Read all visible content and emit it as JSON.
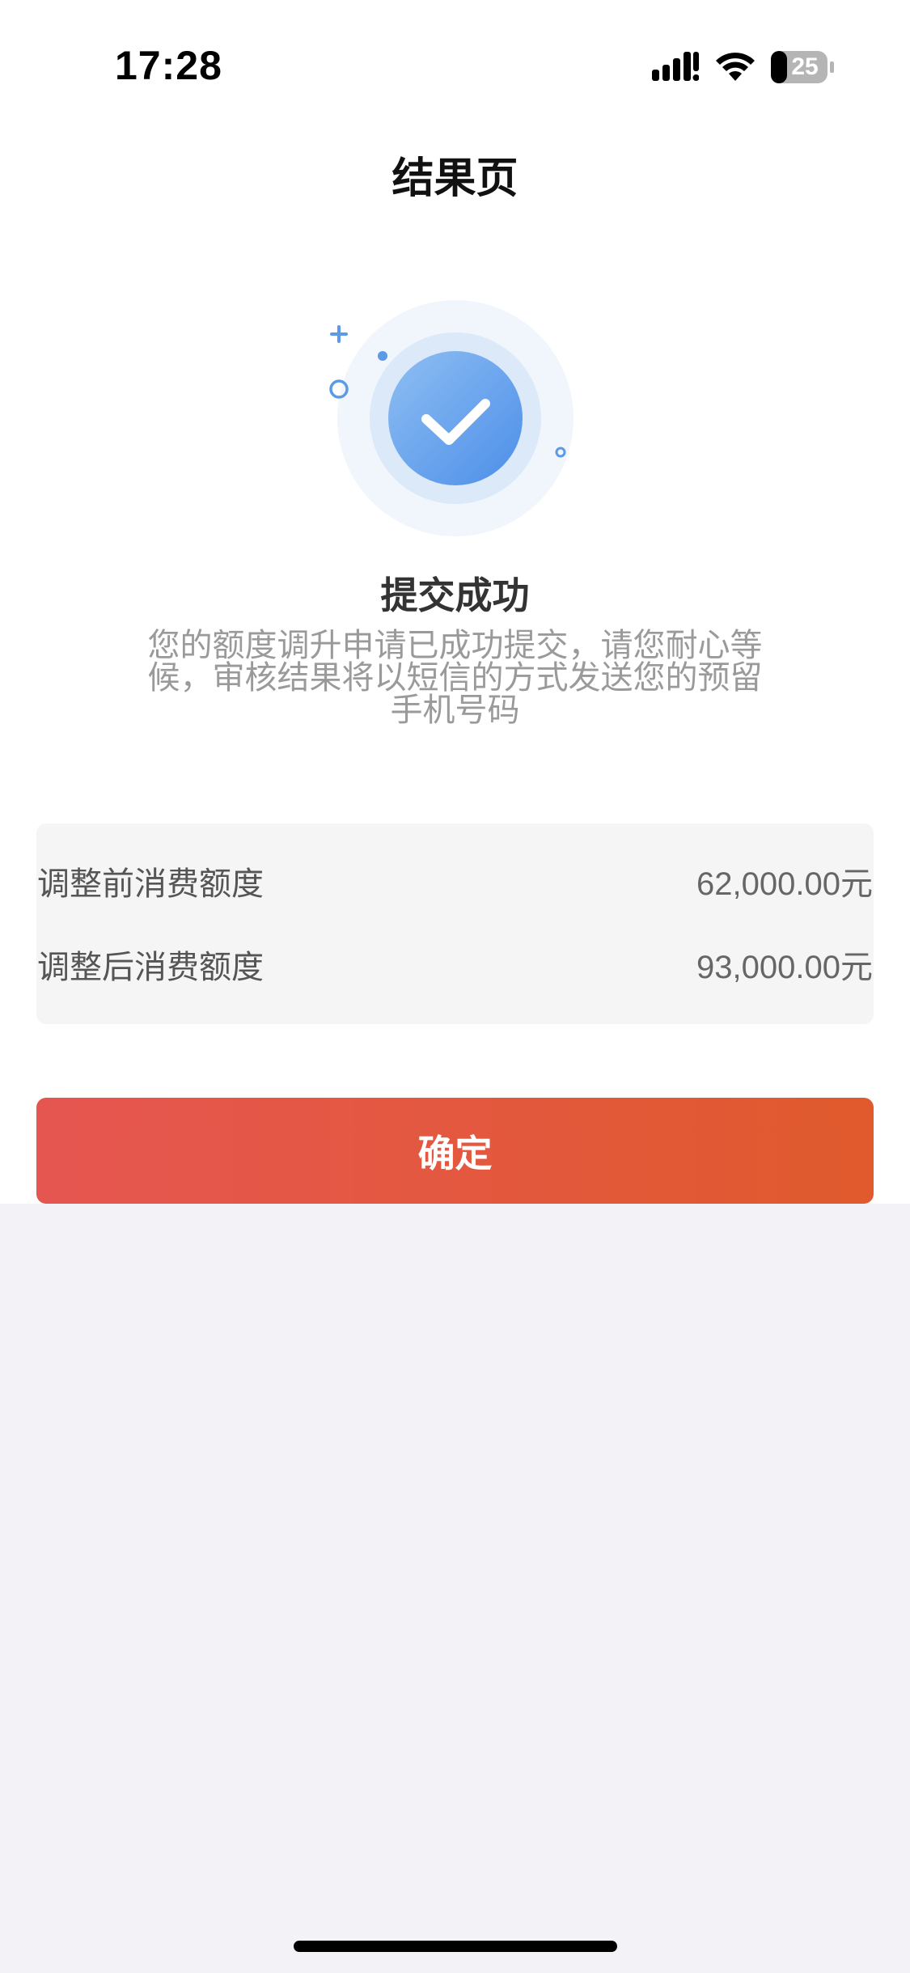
{
  "status_bar": {
    "time": "17:28",
    "battery_level": "25"
  },
  "header": {
    "title": "结果页"
  },
  "result": {
    "title": "提交成功",
    "desc_lines": [
      "您的额度调升申请已成功提交，请您耐心等",
      "候，审核结果将以短信的方式发送您的预留",
      "手机号码"
    ]
  },
  "quota": {
    "rows": [
      {
        "label": "调整前消费额度",
        "value": "62,000.00元"
      },
      {
        "label": "调整后消费额度",
        "value": "93,000.00元"
      }
    ]
  },
  "actions": {
    "confirm_label": "确定"
  },
  "colors": {
    "accent_start": "#e65651",
    "accent_end": "#e05a2d",
    "success_blue": "#5a9ae6",
    "page_bg": "#f2f2f7"
  },
  "icons": [
    "signal-icon",
    "wifi-icon",
    "battery-icon",
    "success-check-icon",
    "sparkle-icon"
  ]
}
